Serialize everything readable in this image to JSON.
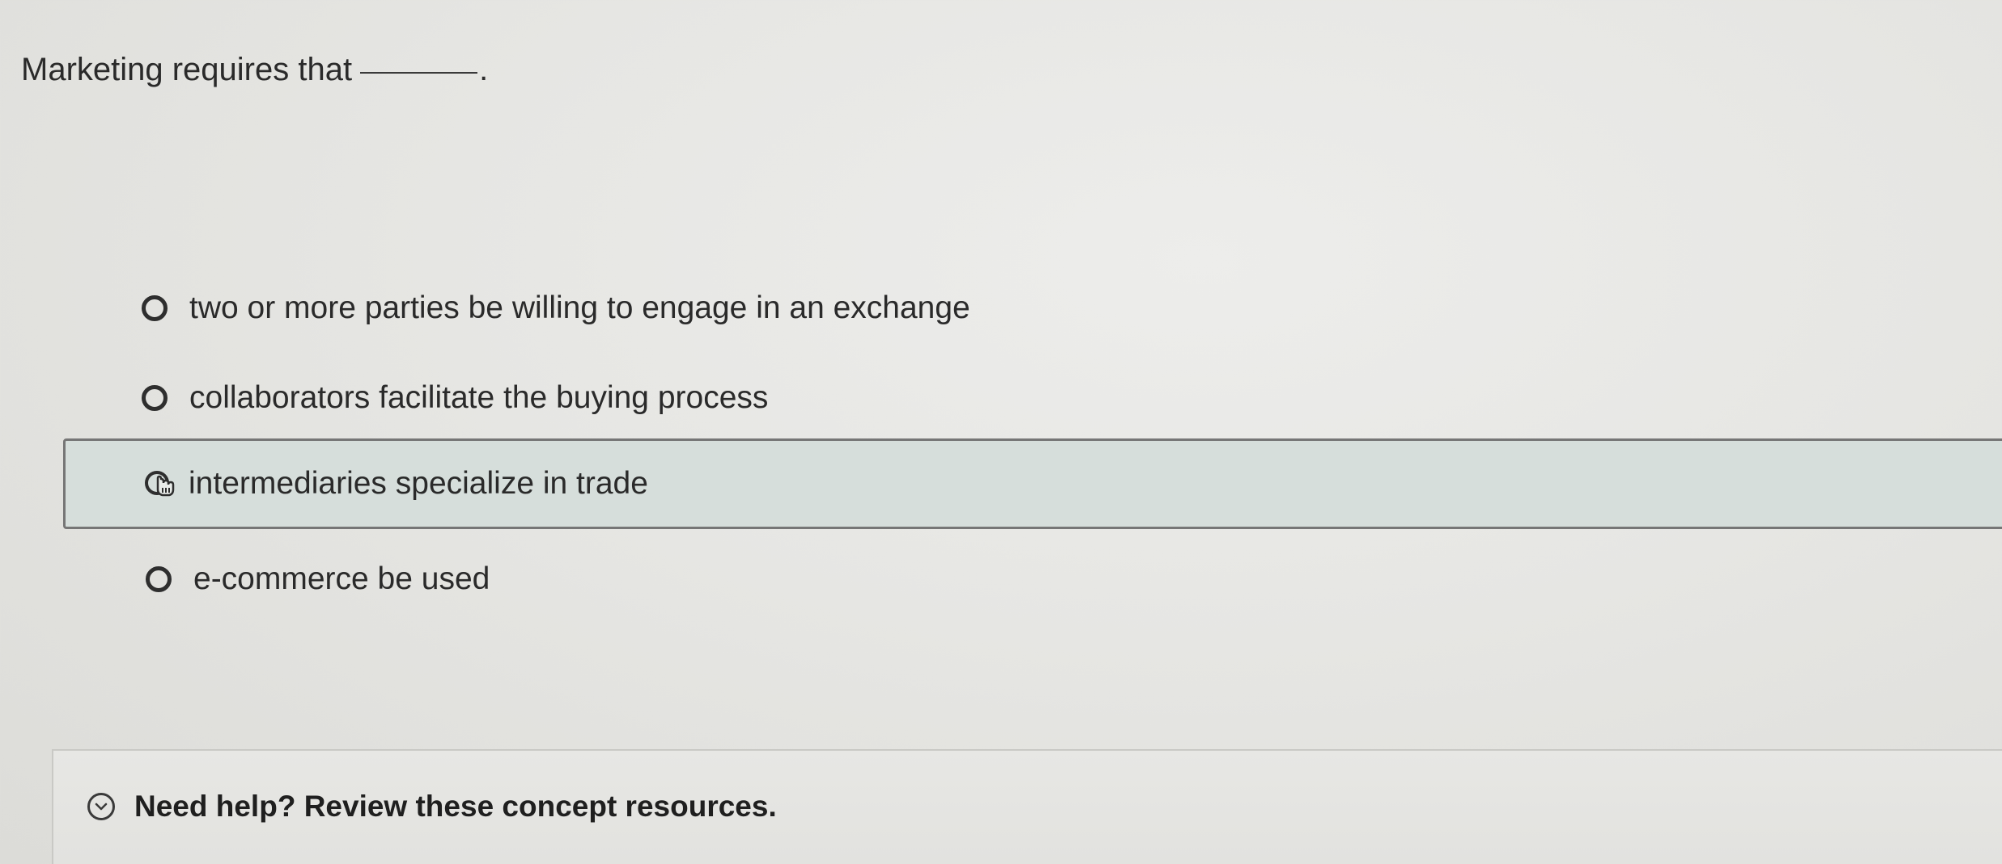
{
  "question": {
    "text": "Marketing requires that",
    "period": "."
  },
  "options": [
    {
      "label": "two or more parties be willing to engage in an exchange",
      "selected": false
    },
    {
      "label": "collaborators facilitate the buying process",
      "selected": false
    },
    {
      "label": "intermediaries specialize in trade",
      "selected": true
    },
    {
      "label": "e-commerce be used",
      "selected": false
    }
  ],
  "help": {
    "label": "Need help? Review these concept resources.",
    "icon": "chevron-down-icon"
  },
  "colors": {
    "selected_background": "#d6dedb",
    "selected_border": "#767676"
  }
}
